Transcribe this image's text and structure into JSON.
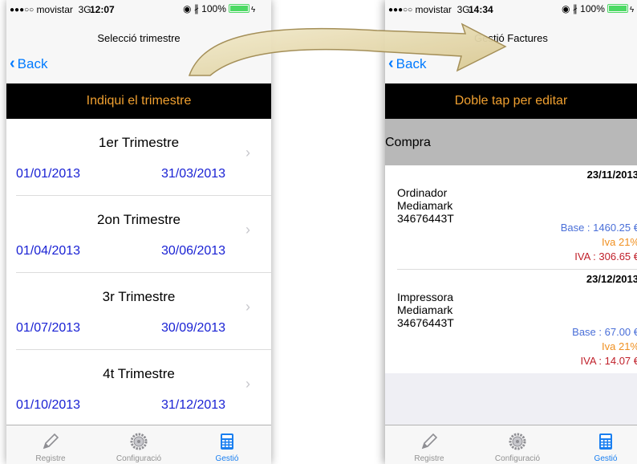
{
  "left": {
    "status": {
      "carrier": "movistar",
      "network": "3G",
      "time": "12:07",
      "battery": "100%"
    },
    "nav": {
      "title": "Selecció trimestre",
      "back": "Back"
    },
    "banner": "Indiqui el trimestre",
    "quarters": [
      {
        "title": "1er Trimestre",
        "start": "01/01/2013",
        "end": "31/03/2013"
      },
      {
        "title": "2on Trimestre",
        "start": "01/04/2013",
        "end": "30/06/2013"
      },
      {
        "title": "3r Trimestre",
        "start": "01/07/2013",
        "end": "30/09/2013"
      },
      {
        "title": "4t Trimestre",
        "start": "01/10/2013",
        "end": "31/12/2013"
      }
    ]
  },
  "right": {
    "status": {
      "carrier": "movistar",
      "network": "3G",
      "time": "14:34",
      "battery": "100%"
    },
    "nav": {
      "title": "Gestió Factures",
      "back": "Back"
    },
    "banner": "Doble tap per editar",
    "section": "Compra",
    "invoices": [
      {
        "date": "23/11/2013",
        "line1": "Ordinador",
        "line2": "Mediamark",
        "line3": "34676443T",
        "base": "Base : 1460.25 €",
        "iva_pct": "Iva 21%",
        "iva": "IVA : 306.65 €"
      },
      {
        "date": "23/12/2013",
        "line1": "Impressora",
        "line2": "Mediamark",
        "line3": "34676443T",
        "base": "Base : 67.00 €",
        "iva_pct": "Iva 21%",
        "iva": "IVA : 14.07 €"
      }
    ]
  },
  "tabs": [
    {
      "label": "Registre",
      "icon": "pencil-icon"
    },
    {
      "label": "Configuració",
      "icon": "gear-icon"
    },
    {
      "label": "Gestió",
      "icon": "calculator-icon",
      "active": true
    }
  ],
  "colors": {
    "accent": "#007aff",
    "banner_text": "#f0a030",
    "date_blue": "#1a22d4",
    "base_blue": "#4a6fd8",
    "iva_orange": "#f09020",
    "iva_red": "#c0202a"
  }
}
